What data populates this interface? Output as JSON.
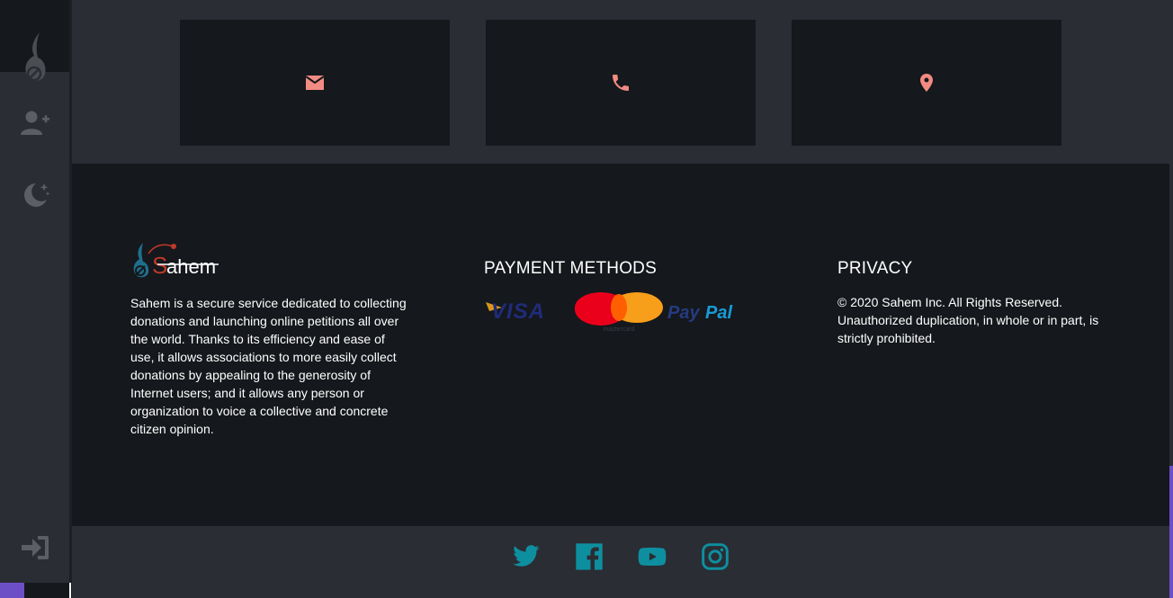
{
  "sidebar": {
    "icons": [
      "saheem-logo-icon",
      "add-user-icon",
      "dark-mode-icon",
      "sign-in-icon"
    ]
  },
  "contact": {
    "cards": [
      {
        "icon": "mail-icon"
      },
      {
        "icon": "phone-icon"
      },
      {
        "icon": "location-pin-icon"
      }
    ],
    "icon_color": "#f28b82"
  },
  "footer": {
    "brand": "Sahem",
    "about": "Sahem is a secure service dedicated to collecting donations and launching online petitions all over the world. Thanks to its efficiency and ease of use, it allows associations to more easily collect donations by appealing to the generosity of Internet users; and it allows any person or organization to voice a collective and concrete citizen opinion.",
    "payment_title": "PAYMENT METHODS",
    "payment_logos": [
      "VISA",
      "mastercard",
      "PayPal"
    ],
    "privacy_title": "PRIVACY",
    "privacy_text": "© 2020 Sahem Inc. All Rights Reserved. Unauthorized duplication, in whole or in part, is strictly prohibited."
  },
  "social": {
    "links": [
      "twitter-icon",
      "facebook-icon",
      "youtube-icon",
      "instagram-icon"
    ],
    "color": "#0e8fa0"
  }
}
